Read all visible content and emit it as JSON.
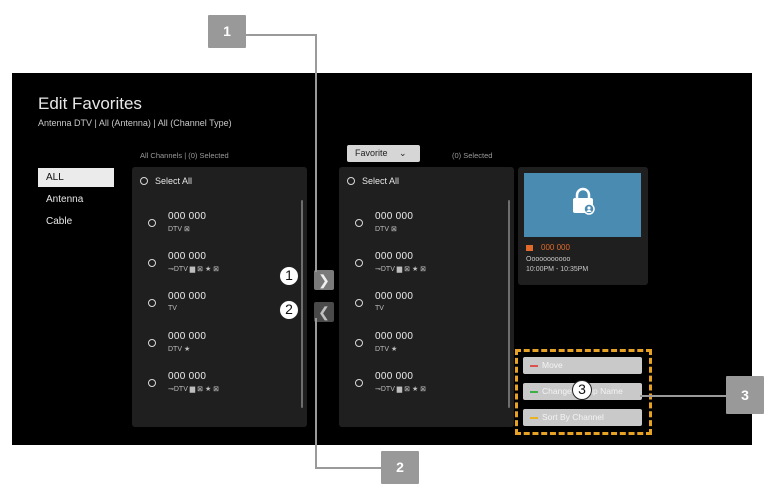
{
  "screen": {
    "title": "Edit Favorites",
    "subtitle": "Antenna DTV | All (Antenna) | All (Channel Type)"
  },
  "sidebar": {
    "items": [
      {
        "label": "ALL",
        "active": true
      },
      {
        "label": "Antenna",
        "active": false
      },
      {
        "label": "Cable",
        "active": false
      }
    ]
  },
  "all_channels": {
    "header": "All Channels | (0) Selected",
    "select_all": "Select All",
    "channels": [
      {
        "number": "000 000",
        "type": "DTV ⊠"
      },
      {
        "number": "000 000",
        "type": "⊸DTV ▆ ⊠ ★ ⊠"
      },
      {
        "number": "000 000",
        "type": "TV"
      },
      {
        "number": "000 000",
        "type": "DTV ★"
      },
      {
        "number": "000 000",
        "type": "⊸DTV ▆ ⊠ ★ ⊠"
      }
    ]
  },
  "favorite": {
    "dropdown_label": "Favorite",
    "header": "(0) Selected",
    "select_all": "Select All",
    "channels": [
      {
        "number": "000 000",
        "type": "DTV ⊠"
      },
      {
        "number": "000 000",
        "type": "⊸DTV ▆ ⊠ ★ ⊠"
      },
      {
        "number": "000 000",
        "type": "TV"
      },
      {
        "number": "000 000",
        "type": "DTV ★"
      },
      {
        "number": "000 000",
        "type": "⊸DTV ▆ ⊠ ★ ⊠"
      }
    ]
  },
  "transfer": {
    "add_glyph": "❯",
    "remove_glyph": "❮"
  },
  "preview": {
    "channel": "000 000",
    "program": "Ooooooooooo",
    "time": "10:00PM - 10:35PM",
    "icon": "lock-icon"
  },
  "actions": [
    {
      "label": "Move",
      "color": "#d9534f"
    },
    {
      "label": "Change Group Name",
      "color": "#3fae49"
    },
    {
      "label": "Sort By Channel",
      "color": "#e8b325"
    }
  ],
  "annotations": {
    "callouts": [
      "1",
      "2",
      "3"
    ],
    "markers": [
      "1",
      "2",
      "3"
    ]
  },
  "colors": {
    "highlight": "#e7a125",
    "callout_bg": "#999999",
    "preview_bg": "#4a8bb2"
  }
}
